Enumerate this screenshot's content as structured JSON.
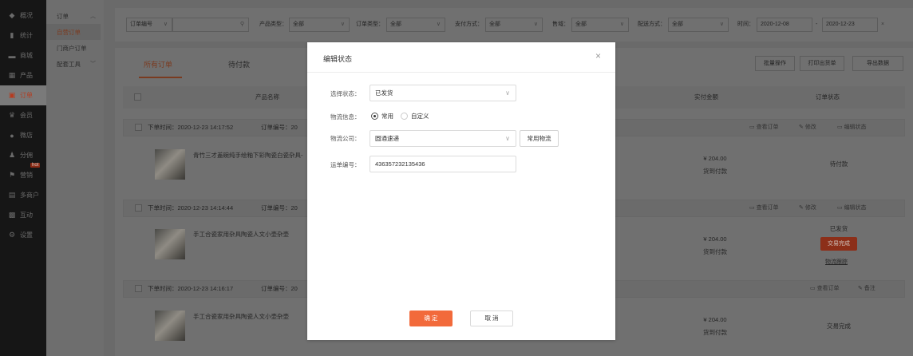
{
  "sidebar": {
    "items": [
      {
        "icon": "layers-icon",
        "glyph": "◆",
        "label": "概况"
      },
      {
        "icon": "chart-icon",
        "glyph": "▮",
        "label": "统计"
      },
      {
        "icon": "shop-icon",
        "glyph": "▬",
        "label": "商城"
      },
      {
        "icon": "grid-icon",
        "glyph": "▦",
        "label": "产品"
      },
      {
        "icon": "order-icon",
        "glyph": "▣",
        "label": "订单"
      },
      {
        "icon": "crown-icon",
        "glyph": "♛",
        "label": "会员"
      },
      {
        "icon": "user-circle-icon",
        "glyph": "●",
        "label": "微店"
      },
      {
        "icon": "share-user-icon",
        "glyph": "♟",
        "label": "分佣"
      },
      {
        "icon": "flag-icon",
        "glyph": "⚑",
        "label": "营销"
      },
      {
        "icon": "merchant-icon",
        "glyph": "▤",
        "label": "多商户"
      },
      {
        "icon": "interaction-icon",
        "glyph": "▩",
        "label": "互动"
      },
      {
        "icon": "settings-icon",
        "glyph": "⚙",
        "label": "设置"
      }
    ],
    "hot_badge": "hot"
  },
  "subnav": {
    "group": "订单",
    "items": [
      "自营订单",
      "门商户订单",
      "配套工具"
    ]
  },
  "filters": {
    "order_no_select": "订单编号",
    "product_type_label": "产品类型：",
    "product_type_value": "全部",
    "order_type_label": "订单类型：",
    "order_type_value": "全部",
    "payment_label": "支付方式：",
    "payment_value": "全部",
    "region_label": "售域：",
    "region_value": "全部",
    "delivery_label": "配送方式：",
    "delivery_value": "全部",
    "time_label": "时间：",
    "date_from": "2020-12-08",
    "date_sep": "-",
    "date_to": "2020-12-23",
    "clear": "×"
  },
  "tabs": {
    "all": "所有订单",
    "pending": "待付款"
  },
  "toolbar": {
    "batch": "批量操作",
    "print": "打印出货单",
    "export": "导出数据"
  },
  "table": {
    "col_product": "产品名称",
    "col_amount": "实付金额",
    "col_status": "订单状态"
  },
  "orders": [
    {
      "time": "下单时间：2020-12-23 14:17:52",
      "order_no": "订单编号：20",
      "actions": [
        "查看订单",
        "修改",
        "编辑状态"
      ],
      "product": "青竹三才盖碗纯手绘釉下彩陶瓷白瓷杂具-",
      "amount": "¥ 204.00",
      "pay_note": "货到付款",
      "status": "待付款"
    },
    {
      "time": "下单时间：2020-12-23 14:14:44",
      "order_no": "订单编号：20",
      "actions": [
        "查看订单",
        "修改",
        "编辑状态"
      ],
      "product": "手工合瓷家用杂具陶瓷人文小壶杂壶",
      "amount": "¥ 204.00",
      "pay_note": "货到付款",
      "status": "已发货",
      "badge": "交易完成",
      "link": "物流跟踪"
    },
    {
      "time": "下单时间：2020-12-23 14:16:17",
      "order_no": "订单编号：20",
      "actions": [
        "查看订单",
        "备注"
      ],
      "product": "手工合瓷家用杂具陶瓷人文小壶杂壶",
      "amount": "¥ 204.00",
      "pay_note": "货到付款",
      "status": "交易完成"
    }
  ],
  "modal": {
    "title": "编辑状态",
    "close": "×",
    "status_label": "选择状态：",
    "status_value": "已发货",
    "logistics_label": "物流信息：",
    "radio_common": "常用",
    "radio_custom": "自定义",
    "company_label": "物流公司：",
    "company_value": "圆通速递",
    "common_logistics_button": "常用物流",
    "tracking_label": "运单编号：",
    "tracking_value": "436357232135436",
    "ok": "确 定",
    "cancel": "取 消"
  }
}
